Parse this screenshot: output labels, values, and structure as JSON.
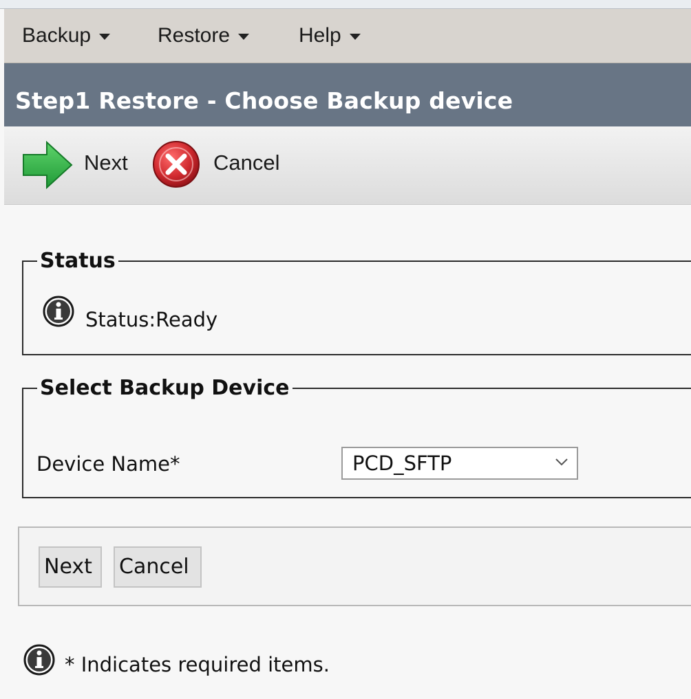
{
  "menu": {
    "items": [
      {
        "label": "Backup",
        "icon": "dropdown-caret"
      },
      {
        "label": "Restore",
        "icon": "dropdown-caret"
      },
      {
        "label": "Help",
        "icon": "dropdown-caret"
      }
    ]
  },
  "page": {
    "title": "Step1 Restore - Choose Backup device"
  },
  "toolbar": {
    "next_label": "Next",
    "next_icon": "green-arrow-right-icon",
    "cancel_label": "Cancel",
    "cancel_icon": "red-x-circle-icon"
  },
  "status": {
    "legend": "Status",
    "text": "Status:Ready",
    "icon": "info-icon"
  },
  "device": {
    "legend": "Select Backup Device",
    "label": "Device Name*",
    "selected": "PCD_SFTP"
  },
  "buttons": {
    "next_label": "Next",
    "cancel_label": "Cancel"
  },
  "footer": {
    "note": "* Indicates required items.",
    "icon": "info-icon"
  },
  "colors": {
    "menubar_bg": "#d8d4cf",
    "titlebar_bg": "#687585",
    "next_green": "#2fb24a",
    "cancel_red": "#c4212a"
  }
}
